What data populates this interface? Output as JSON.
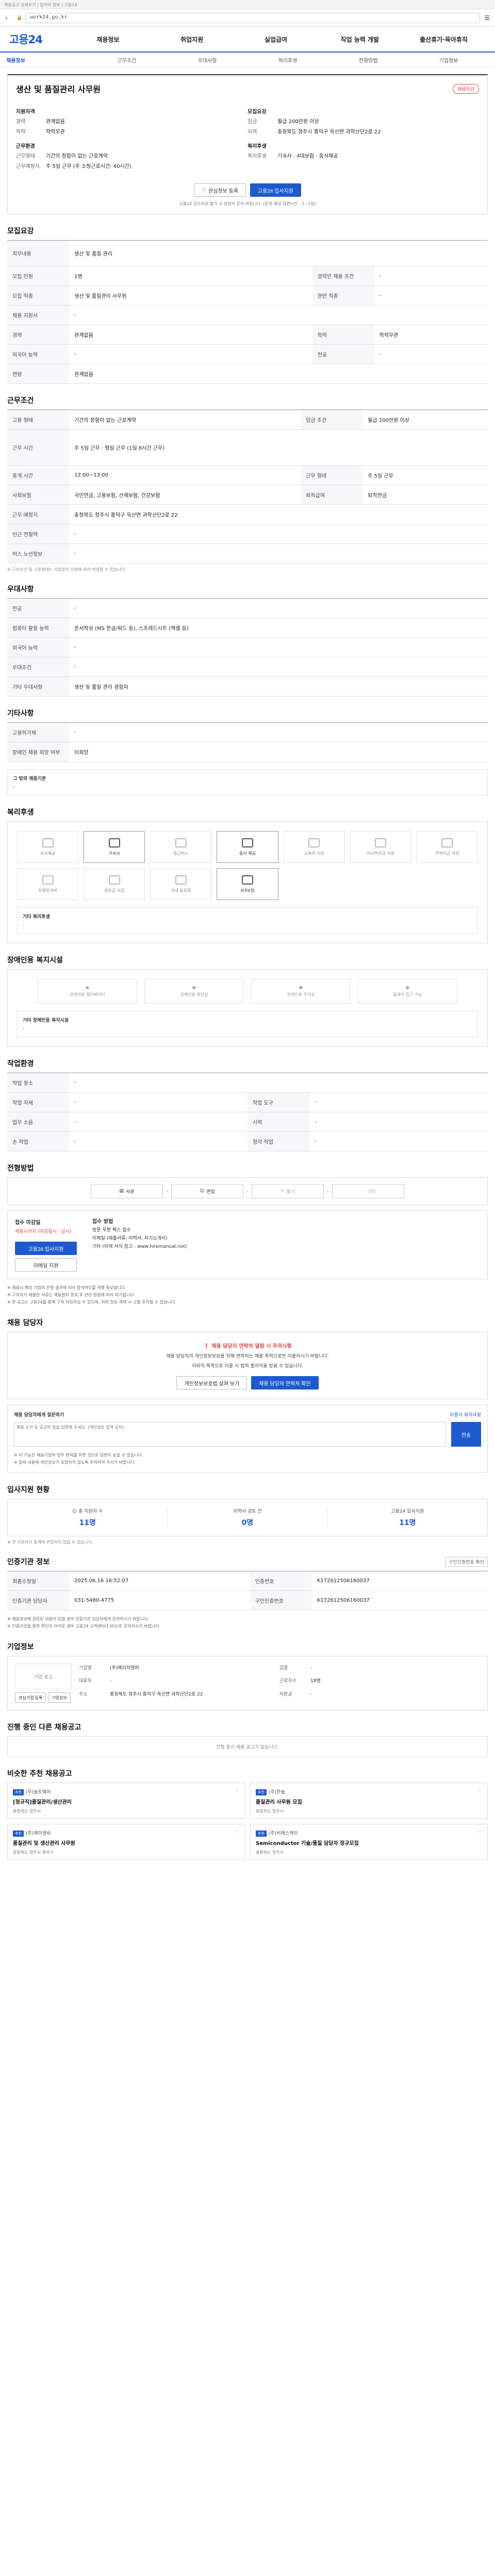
{
  "browser": {
    "top_text": "채용공고 상세보기 | 일자리 정보 | 고용24",
    "url": "work24.go.kr"
  },
  "site": {
    "logo": "고용24",
    "gnb": [
      "채용정보",
      "취업지원",
      "실업급여",
      "직업 능력 개발",
      "출산휴가·육아휴직"
    ],
    "subnav": [
      "채용정보",
      "근무조건",
      "우대사항",
      "복리후생",
      "전형방법",
      "기업정보"
    ]
  },
  "job": {
    "title": "생산 및 품질관리 사무원",
    "badge": "채용마감",
    "left_group": "지원자격",
    "left_group2": "근무환경",
    "left": [
      {
        "k": "경력",
        "v": "관계없음"
      },
      {
        "k": "학력",
        "v": "학력무관"
      },
      {
        "k": "근무형태",
        "v": "기간의 정함이 없는 근로계약"
      },
      {
        "k": "근무예정지",
        "v": "주 5일 근무 (주 소정근로시간: 40시간)"
      }
    ],
    "right_group": "모집요강",
    "right_group2": "복리후생",
    "right": [
      {
        "k": "임금",
        "v": "월급 200만원 이상"
      },
      {
        "k": "지역",
        "v": "충청북도 청주시 흥덕구 옥산면 과학산단2로 22"
      },
      {
        "k": "복리후생",
        "v": "기숙사 · 4대보험 · 중식제공"
      }
    ],
    "btn_save": "관심정보 등록",
    "btn_apply": "고용24 입사지원",
    "note": "고용24 입사지원 불가 시 담당자 문의 바랍니다. (문의 예상 답변시간 : 1~3일)"
  },
  "recruit": {
    "title": "모집요강",
    "rows": [
      {
        "k": "직무내용",
        "v": "생산 및 품질 관리"
      },
      {
        "k": "모집 인원",
        "v": "1명",
        "k2": "경력인 채용 조건",
        "v2": "-"
      },
      {
        "k": "모집 직종",
        "v": "생산 및 품질관리 사무원",
        "k2": "관련 직종",
        "v2": "-"
      },
      {
        "k": "채용 지원서",
        "v": "-"
      },
      {
        "k": "경력",
        "v": "관계없음",
        "k2": "학력",
        "v2": "학력무관"
      },
      {
        "k": "외국어 능력",
        "v": "-",
        "k2": "전공",
        "v2": "-"
      },
      {
        "k": "연령",
        "v": "관계없음"
      }
    ]
  },
  "work": {
    "title": "근무조건",
    "rows": [
      {
        "k": "고용 형태",
        "v": "기간의 정함이 없는 근로계약",
        "k2": "임금 조건",
        "v2": "월급 200만원 이상"
      },
      {
        "k": "근무 시간",
        "v": "주 5일 근무 · 평일 근무 (1일 8시간 근무)"
      },
      {
        "k": "휴게 시간",
        "v": "12:00~13:00",
        "k2": "근무 형태",
        "v2": "주 5일 근무"
      },
      {
        "k": "사회보험",
        "v": "국민연금, 고용보험, 산재보험, 건강보험",
        "k2": "퇴직급여",
        "v2": "퇴직연금"
      },
      {
        "k": "근무 예정지",
        "v": "충청북도 청주시 흥덕구 옥산면 과학산단2로 22"
      },
      {
        "k": "인근 전철역",
        "v": "-"
      },
      {
        "k": "버스 노선정보",
        "v": "-"
      }
    ],
    "note": "※ 근로조건 및 고용형태는 사업장의 사정에 따라 변경될 수 있습니다."
  },
  "prefer": {
    "title": "우대사항",
    "rows": [
      {
        "k": "전공",
        "v": "-"
      },
      {
        "k": "컴퓨터 활용 능력",
        "v": "문서작성 (MS 한글/워드 등), 스프레드시트 (엑셀 등)"
      },
      {
        "k": "외국어 능력",
        "v": "-"
      },
      {
        "k": "우대조건",
        "v": "-"
      },
      {
        "k": "기타 우대사항",
        "v": "생산 및 품질 관리 경험자"
      }
    ]
  },
  "etc": {
    "title": "기타사항",
    "rows": [
      {
        "k": "고용허가제",
        "v": "-"
      },
      {
        "k": "장애인 채용 희망 여부",
        "v": "미희망"
      }
    ],
    "subbox_title": "그 밖의 채용기준",
    "subbox_text": "-"
  },
  "welfare": {
    "title": "복리후생",
    "items": [
      {
        "label": "숙식제공",
        "on": false
      },
      {
        "label": "기숙사",
        "on": true
      },
      {
        "label": "통근버스",
        "on": false
      },
      {
        "label": "중식 제공",
        "on": true
      },
      {
        "label": "교육비 지원",
        "on": false
      },
      {
        "label": "자녀학자금 지원",
        "on": false
      },
      {
        "label": "주택자금 지원",
        "on": false
      },
      {
        "label": "차량유지비",
        "on": false
      },
      {
        "label": "경조금 지급",
        "on": false
      },
      {
        "label": "사내 동호회",
        "on": false
      },
      {
        "label": "4대보험",
        "on": true
      }
    ],
    "subbox_title": "기타 복리후생",
    "subbox_text": "-"
  },
  "disabled": {
    "title": "장애인용 복지시설",
    "items": [
      "장애인용 엘리베이터",
      "장애인용 화장실",
      "장애인용 주차장",
      "휠체어 접근 가능"
    ],
    "subbox_title": "기타 장애인용 복지시설",
    "subbox_text": "-"
  },
  "work_env": {
    "title": "작업환경",
    "rows": [
      {
        "k": "작업 장소",
        "v": "-"
      },
      {
        "k": "작업 자세",
        "v": "-",
        "k2": "작업 도구",
        "v2": "-"
      },
      {
        "k": "업무 소음",
        "v": "-",
        "k2": "시력",
        "v2": "-"
      },
      {
        "k": "손 작업",
        "v": "-",
        "k2": "청각 작업",
        "v2": "-"
      }
    ]
  },
  "process": {
    "title": "전형방법",
    "steps": [
      {
        "label": "서류",
        "on": true
      },
      {
        "label": "면접",
        "on": true
      },
      {
        "label": "필기",
        "on": false
      },
      {
        "label": "기타",
        "on": false
      }
    ],
    "left_title": "접수 마감일",
    "left_sub": "채용시까지 (마감일시 : 상시)",
    "btn_apply": "고용24 입사지원",
    "btn_email": "이메일 지원",
    "right_title": "접수 방법",
    "right_lines": [
      "방문 우편 팩스 접수",
      "이메일 (제출서류: 이력서, 자기소개서)",
      "기타 (아래 서식 참고 : www.hiremanual.net)"
    ],
    "warnings": [
      "※ 채용시 해당 기업의 전형 결과에 따라 합격여부를 개별 통보합니다.",
      "※ 구직자가 제출한 서류는 채용절차 종료 후 관련 법령에 따라 파기됩니다.",
      "※ 본 공고는 고용24를 통해 구직 지원하실 수 있으며, 허위 정보 게재 시 고발 조치될 수 있습니다."
    ]
  },
  "hr": {
    "title": "채용 담당자",
    "alert": "채용 담당자 연락처 열람 시 주의사항",
    "p1": "채용 담당자의 개인정보보호를 위해 연락처는 채용 목적으로만 이용하시기 바랍니다.",
    "p2": "이외의 목적으로 이용 시 법적 불이익을 받을 수 있습니다.",
    "btn1": "개인정보보호법 살펴 보기",
    "btn2": "채용 담당자 연락처 확인",
    "inq_title": "채용 담당자에게 질문하기",
    "inq_right": "이용시 유의사항",
    "placeholder": "채용 조건 등 궁금한 점을 입력해 주세요. (개인정보 입력 금지)",
    "send": "전송",
    "notes": [
      "※ 이 기능은 채용기업의 업무 편의를 위한 것으로 답변이 늦을 수 있습니다.",
      "※ 질의 내용에 개인정보가 포함되지 않도록 주의하여 주시기 바랍니다."
    ]
  },
  "stats": {
    "title": "입사지원 현황",
    "items": [
      {
        "label": "총 지원자 수",
        "value": "11명"
      },
      {
        "label": "이력서 검토 전",
        "value": "0명"
      },
      {
        "label": "고용24 입사지원",
        "value": "11명"
      }
    ],
    "note": "※ 전 지원자가 통계에 반영되지 않을 수 있습니다."
  },
  "cert": {
    "title": "인증기관 정보",
    "right": "구인인증번호 확인",
    "rows": [
      {
        "k": "최종수정일",
        "v": "2025.06.16 16:52:07",
        "k2": "인증번호",
        "v2": "K172612506160037"
      },
      {
        "k": "인증기관 담당자",
        "v": "031-5480-4775",
        "k2": "구인인증번호",
        "v2": "K172612506160037"
      }
    ],
    "notes": [
      "※ 채용정보에 잘못된 내용이 있을 경우 인증기관 담당자에게 문의하시기 바랍니다.",
      "※ 인증기관을 통한 확인이 어려운 경우 고용24 고객센터(1350)로 문의하시기 바랍니다."
    ]
  },
  "company": {
    "title": "기업정보",
    "logo_text": "기업 로고",
    "btn1": "관심기업 등록",
    "btn2": "기업정보",
    "info": [
      {
        "k": "기업명",
        "v": "(주)에이치엠피",
        "k2": "업종",
        "v2": "-"
      },
      {
        "k": "대표자",
        "v": "-",
        "k2": "근로자수",
        "v2": "18명"
      },
      {
        "k": "주소",
        "v": "충청북도 청주시 흥덕구 옥산면 과학산단2로 22",
        "k2": "자본금",
        "v2": "-"
      }
    ]
  },
  "other": {
    "title": "진행 중인 다른 채용공고",
    "right": "",
    "empty": "진행 중인 채용 공고가 없습니다."
  },
  "recommend": {
    "title": "비슷한 추천 채용공고",
    "items": [
      {
        "co": "(주)솔트웨어",
        "title": "[정규직]품질관리/생산관리",
        "meta": "충청북도 청주시"
      },
      {
        "co": "(주)한솔",
        "title": "품질관리 사무원 모집",
        "meta": "충청북도 청주시"
      },
      {
        "co": "(주)제이앤씨",
        "title": "품질관리 및 생산관리 사무원",
        "meta": "충청북도 청주시 흥덕구"
      },
      {
        "co": "(주)비에스케이",
        "title": "Semiconductor 기술/품질 담당자 정규모집",
        "meta": "충청북도 청주시"
      }
    ]
  }
}
